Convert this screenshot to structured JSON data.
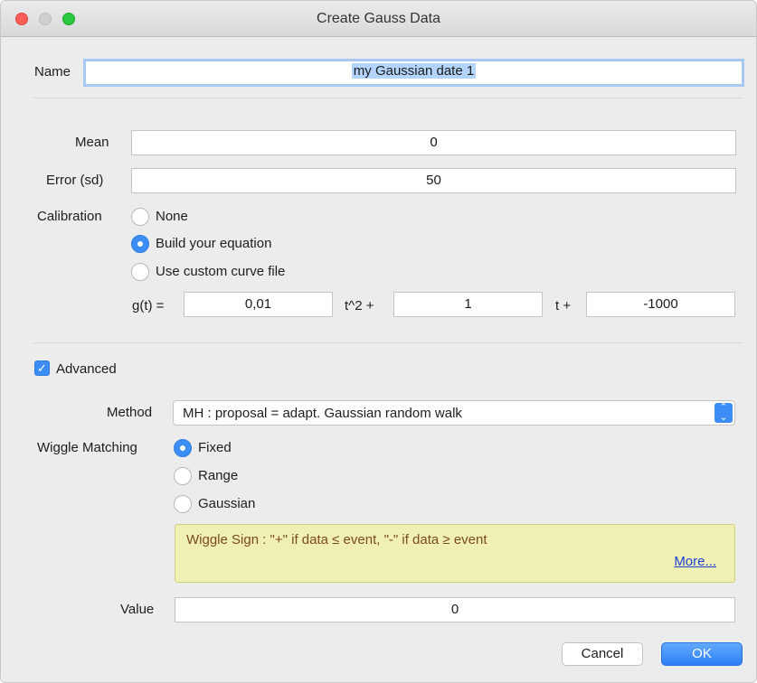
{
  "window": {
    "title": "Create Gauss Data"
  },
  "name": {
    "label": "Name",
    "value": "my Gaussian date 1"
  },
  "mean": {
    "label": "Mean",
    "value": "0"
  },
  "error": {
    "label": "Error (sd)",
    "value": "50"
  },
  "calibration": {
    "label": "Calibration",
    "options": [
      "None",
      "Build your equation",
      "Use custom curve file"
    ],
    "selected": "Build your equation"
  },
  "equation": {
    "g_label": "g(t) =",
    "a": "0,01",
    "t2_label": "t^2 +",
    "b": "1",
    "t_label": "t +",
    "c": "-1000"
  },
  "advanced": {
    "label": "Advanced",
    "checked": true
  },
  "method": {
    "label": "Method",
    "selected": "MH : proposal = adapt. Gaussian random walk"
  },
  "wiggle": {
    "label": "Wiggle Matching",
    "options": [
      "Fixed",
      "Range",
      "Gaussian"
    ],
    "selected": "Fixed",
    "note": "Wiggle Sign : \"+\" if data ≤ event, \"-\" if data ≥ event",
    "more_link": "More..."
  },
  "value": {
    "label": "Value",
    "value": "0"
  },
  "buttons": {
    "cancel": "Cancel",
    "ok": "OK"
  },
  "colors": {
    "accent": "#3c8ef6",
    "note_bg": "#f0f0b4",
    "close": "#fe5f57",
    "max": "#28c840"
  }
}
